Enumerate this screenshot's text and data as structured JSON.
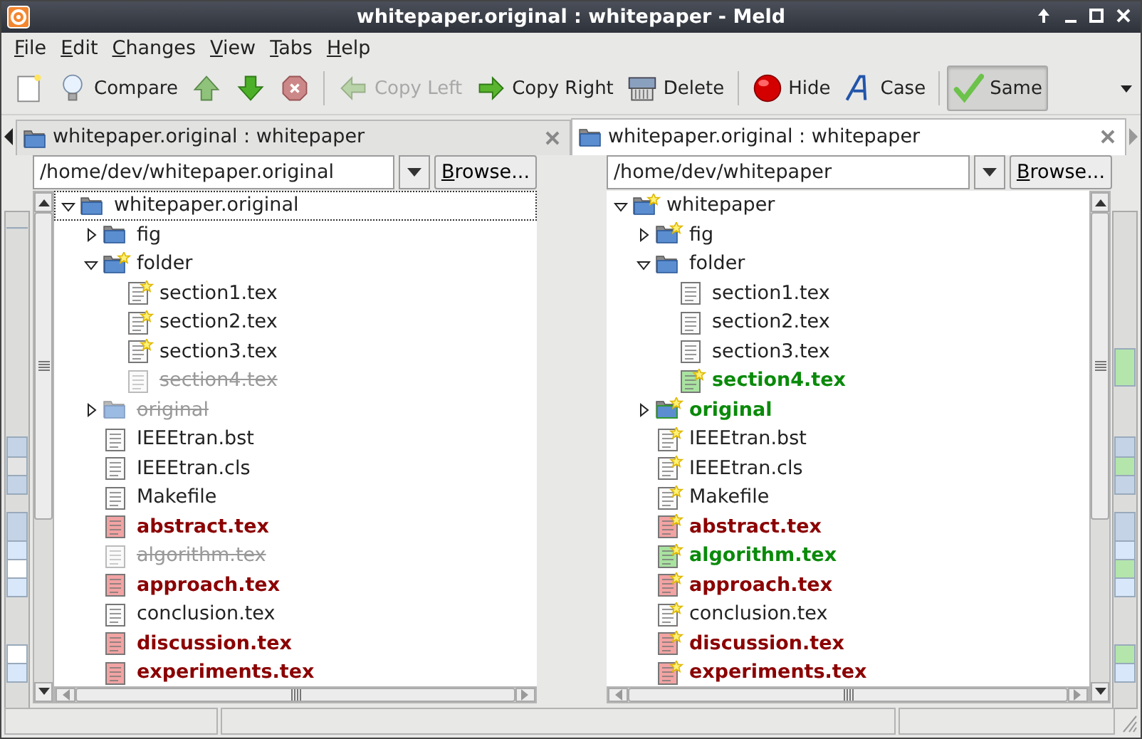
{
  "window": {
    "title": "whitepaper.original : whitepaper - Meld"
  },
  "menu": [
    "File",
    "Edit",
    "Changes",
    "View",
    "Tabs",
    "Help"
  ],
  "toolbar": [
    {
      "kind": "icon"
    },
    {
      "kind": "button",
      "label": "Compare"
    },
    {
      "kind": "icon"
    },
    {
      "kind": "icon"
    },
    {
      "kind": "icon"
    },
    {
      "kind": "separator"
    },
    {
      "kind": "button",
      "label": "Copy Left",
      "disabled": true
    },
    {
      "kind": "button",
      "label": "Copy Right",
      "disabled": false
    },
    {
      "kind": "button",
      "label": "Delete",
      "disabled": false
    },
    {
      "kind": "separator"
    },
    {
      "kind": "toggle",
      "label": "Hide",
      "pressed": false
    },
    {
      "kind": "toggle",
      "label": "Case",
      "pressed": false
    },
    {
      "kind": "separator"
    },
    {
      "kind": "toggle",
      "label": "Same",
      "pressed": true
    }
  ],
  "tabs": [
    {
      "label": "whitepaper.original : whitepaper",
      "selected": false
    },
    {
      "label": "whitepaper.original : whitepaper",
      "selected": true
    }
  ],
  "panes": [
    {
      "path": "/home/dev/whitepaper.original",
      "browse": "Browse...",
      "tree": [
        {
          "name": "whitepaper.original",
          "kind": "folder",
          "changed": false,
          "added": false,
          "missing": false,
          "newer": false,
          "expanded": true,
          "focused": true,
          "children": [
            {
              "name": "fig",
              "kind": "folder",
              "changed": false,
              "added": false,
              "missing": false,
              "newer": false,
              "expanded": false,
              "focused": false
            },
            {
              "name": "folder",
              "kind": "folder",
              "changed": false,
              "added": false,
              "missing": false,
              "newer": true,
              "expanded": true,
              "focused": false,
              "children": [
                {
                  "name": "section1.tex",
                  "kind": "file",
                  "changed": false,
                  "added": false,
                  "missing": false,
                  "newer": true,
                  "focused": false
                },
                {
                  "name": "section2.tex",
                  "kind": "file",
                  "changed": false,
                  "added": false,
                  "missing": false,
                  "newer": true,
                  "focused": false
                },
                {
                  "name": "section3.tex",
                  "kind": "file",
                  "changed": false,
                  "added": false,
                  "missing": false,
                  "newer": true,
                  "focused": false
                },
                {
                  "name": "section4.tex",
                  "kind": "file",
                  "changed": false,
                  "added": false,
                  "missing": true,
                  "newer": false,
                  "focused": false
                }
              ]
            },
            {
              "name": "original",
              "kind": "folder",
              "changed": false,
              "added": false,
              "missing": true,
              "newer": false,
              "expanded": false,
              "focused": false
            },
            {
              "name": "IEEEtran.bst",
              "kind": "file",
              "changed": false,
              "added": false,
              "missing": false,
              "newer": false,
              "focused": false
            },
            {
              "name": "IEEEtran.cls",
              "kind": "file",
              "changed": false,
              "added": false,
              "missing": false,
              "newer": false,
              "focused": false
            },
            {
              "name": "Makefile",
              "kind": "file",
              "changed": false,
              "added": false,
              "missing": false,
              "newer": false,
              "focused": false
            },
            {
              "name": "abstract.tex",
              "kind": "file",
              "changed": true,
              "added": false,
              "missing": false,
              "newer": false,
              "focused": false
            },
            {
              "name": "algorithm.tex",
              "kind": "file",
              "changed": false,
              "added": false,
              "missing": true,
              "newer": false,
              "focused": false
            },
            {
              "name": "approach.tex",
              "kind": "file",
              "changed": true,
              "added": false,
              "missing": false,
              "newer": false,
              "focused": false
            },
            {
              "name": "conclusion.tex",
              "kind": "file",
              "changed": false,
              "added": false,
              "missing": false,
              "newer": false,
              "focused": false
            },
            {
              "name": "discussion.tex",
              "kind": "file",
              "changed": true,
              "added": false,
              "missing": false,
              "newer": false,
              "focused": false
            },
            {
              "name": "experiments.tex",
              "kind": "file",
              "changed": true,
              "added": false,
              "missing": false,
              "newer": false,
              "focused": false
            }
          ]
        }
      ]
    },
    {
      "path": "/home/dev/whitepaper",
      "browse": "Browse...",
      "tree": [
        {
          "name": "whitepaper",
          "kind": "folder",
          "changed": false,
          "added": false,
          "missing": false,
          "newer": true,
          "expanded": true,
          "focused": false,
          "children": [
            {
              "name": "fig",
              "kind": "folder",
              "changed": false,
              "added": false,
              "missing": false,
              "newer": true,
              "expanded": false,
              "focused": false
            },
            {
              "name": "folder",
              "kind": "folder",
              "changed": false,
              "added": false,
              "missing": false,
              "newer": false,
              "expanded": true,
              "focused": false,
              "children": [
                {
                  "name": "section1.tex",
                  "kind": "file",
                  "changed": false,
                  "added": false,
                  "missing": false,
                  "newer": false,
                  "focused": false
                },
                {
                  "name": "section2.tex",
                  "kind": "file",
                  "changed": false,
                  "added": false,
                  "missing": false,
                  "newer": false,
                  "focused": false
                },
                {
                  "name": "section3.tex",
                  "kind": "file",
                  "changed": false,
                  "added": false,
                  "missing": false,
                  "newer": false,
                  "focused": false
                },
                {
                  "name": "section4.tex",
                  "kind": "file",
                  "changed": false,
                  "added": true,
                  "missing": false,
                  "newer": true,
                  "focused": false
                }
              ]
            },
            {
              "name": "original",
              "kind": "folder",
              "changed": false,
              "added": true,
              "missing": false,
              "newer": true,
              "expanded": false,
              "focused": false
            },
            {
              "name": "IEEEtran.bst",
              "kind": "file",
              "changed": false,
              "added": false,
              "missing": false,
              "newer": true,
              "focused": false
            },
            {
              "name": "IEEEtran.cls",
              "kind": "file",
              "changed": false,
              "added": false,
              "missing": false,
              "newer": true,
              "focused": false
            },
            {
              "name": "Makefile",
              "kind": "file",
              "changed": false,
              "added": false,
              "missing": false,
              "newer": true,
              "focused": false
            },
            {
              "name": "abstract.tex",
              "kind": "file",
              "changed": true,
              "added": false,
              "missing": false,
              "newer": true,
              "focused": false
            },
            {
              "name": "algorithm.tex",
              "kind": "file",
              "changed": false,
              "added": true,
              "missing": false,
              "newer": true,
              "focused": false
            },
            {
              "name": "approach.tex",
              "kind": "file",
              "changed": true,
              "added": false,
              "missing": false,
              "newer": true,
              "focused": false
            },
            {
              "name": "conclusion.tex",
              "kind": "file",
              "changed": false,
              "added": false,
              "missing": false,
              "newer": true,
              "focused": false
            },
            {
              "name": "discussion.tex",
              "kind": "file",
              "changed": true,
              "added": false,
              "missing": false,
              "newer": true,
              "focused": false
            },
            {
              "name": "experiments.tex",
              "kind": "file",
              "changed": true,
              "added": false,
              "missing": false,
              "newer": true,
              "focused": false
            }
          ]
        }
      ]
    }
  ]
}
